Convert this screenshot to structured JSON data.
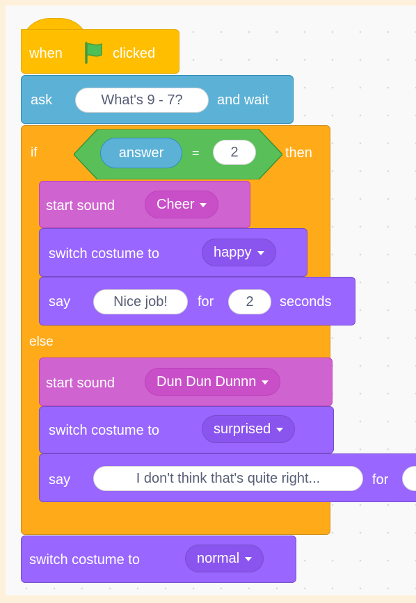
{
  "when_block": {
    "when_label": "when",
    "clicked_label": "clicked",
    "flag_icon": "green-flag-icon"
  },
  "ask_block": {
    "label": "ask",
    "question": "What's 9 - 7?",
    "suffix": "and wait"
  },
  "if_block": {
    "if_label": "if",
    "then_label": "then",
    "else_label": "else",
    "condition": {
      "left": "answer",
      "operator": "=",
      "right": "2"
    }
  },
  "then_branch": {
    "sound_block": {
      "label": "start sound",
      "sound": "Cheer"
    },
    "costume_block": {
      "label": "switch costume to",
      "costume": "happy"
    },
    "say_block": {
      "label": "say",
      "message": "Nice job!",
      "for_label": "for",
      "seconds": "2",
      "seconds_label": "seconds"
    }
  },
  "else_branch": {
    "sound_block": {
      "label": "start sound",
      "sound": "Dun Dun Dunnn"
    },
    "costume_block": {
      "label": "switch costume to",
      "costume": "surprised"
    },
    "say_block": {
      "label": "say",
      "message": "I don't think that's quite right...",
      "for_label": "for"
    }
  },
  "final_block": {
    "label": "switch costume to",
    "costume": "normal"
  },
  "colors": {
    "events": "#ffbf00",
    "sensing": "#5cb1d6",
    "control": "#ffab19",
    "operators": "#59c059",
    "sound": "#cf63cf",
    "looks": "#9966ff"
  }
}
